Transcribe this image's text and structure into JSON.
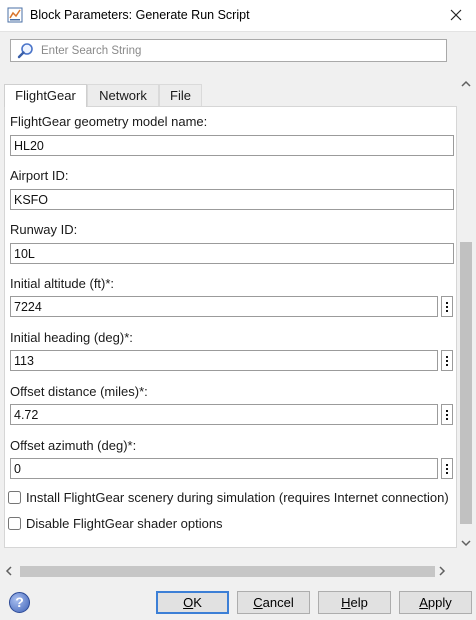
{
  "window": {
    "title": "Block Parameters: Generate Run Script",
    "app_icon": "matlab-simulink-icon",
    "close_icon": "close-x-icon"
  },
  "search": {
    "placeholder": "Enter Search String",
    "value": ""
  },
  "tabs": [
    {
      "label": "FlightGear",
      "active": true
    },
    {
      "label": "Network",
      "active": false
    },
    {
      "label": "File",
      "active": false
    }
  ],
  "fields": {
    "geometry_model": {
      "label": "FlightGear geometry model name:",
      "value": "HL20"
    },
    "airport_id": {
      "label": "Airport ID:",
      "value": "KSFO"
    },
    "runway_id": {
      "label": "Runway ID:",
      "value": "10L"
    },
    "initial_altitude": {
      "label": "Initial altitude (ft)*:",
      "value": "7224"
    },
    "initial_heading": {
      "label": "Initial heading (deg)*:",
      "value": "113"
    },
    "offset_distance": {
      "label": "Offset distance (miles)*:",
      "value": "4.72"
    },
    "offset_azimuth": {
      "label": "Offset azimuth (deg)*:",
      "value": "0"
    }
  },
  "checkboxes": [
    {
      "label": "Install FlightGear scenery during simulation (requires Internet connection)",
      "checked": false
    },
    {
      "label": "Disable FlightGear shader options",
      "checked": false
    }
  ],
  "buttons": {
    "ok": {
      "label": "OK",
      "underline": "O",
      "rest": "K"
    },
    "cancel": {
      "label": "Cancel",
      "underline": "C",
      "rest": "ancel"
    },
    "help": {
      "label": "Help",
      "underline": "H",
      "rest": "elp"
    },
    "apply": {
      "label": "Apply",
      "underline": "A",
      "rest": "pply"
    },
    "help_icon": "?"
  },
  "colors": {
    "default_button_border": "#3c7fd6",
    "panel_bg": "#ffffff",
    "dialog_bg": "#f0f0f0"
  }
}
